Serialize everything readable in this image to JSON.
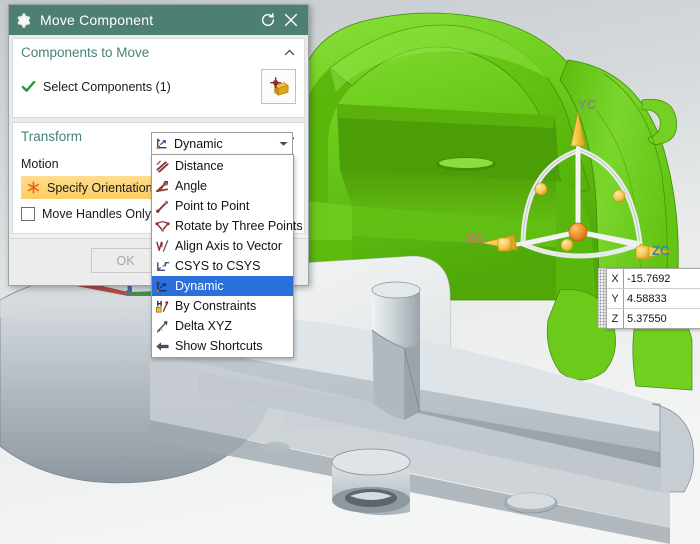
{
  "window": {
    "title": "Move Component",
    "title_icon": "gear-icon",
    "reset_icon": "reset-circular-arrow-icon",
    "close_icon": "close-x-icon",
    "title_bar_color": "#4e7f73"
  },
  "groups": [
    {
      "header": "Components to Move",
      "collapse_icon": "chevron-up-icon",
      "select_components": {
        "label": "Select Components (1)",
        "status_icon": "green-check-icon",
        "button_icon": "select-cube-crosshair-icon"
      }
    },
    {
      "header": "Transform",
      "collapse_icon": "chevron-up-icon",
      "motion_label": "Motion",
      "specify_orientation": {
        "label": "Specify Orientation",
        "icon": "orange-asterisk-icon",
        "highlight_color": "#fccd62"
      },
      "move_handles_only": {
        "label": "Move Handles Only",
        "checked": false
      }
    }
  ],
  "footer": {
    "ok_label": "OK",
    "ok_enabled": false
  },
  "motion_combo": {
    "selected": "Dynamic",
    "icon": "dynamic-csys-icon",
    "arrow_icon": "chevron-down-icon",
    "expanded": true,
    "options": [
      {
        "label": "Distance",
        "icon": "distance-icon",
        "selected": false
      },
      {
        "label": "Angle",
        "icon": "angle-icon",
        "selected": false
      },
      {
        "label": "Point to Point",
        "icon": "point-to-point-icon",
        "selected": false
      },
      {
        "label": "Rotate by Three Points",
        "icon": "rotate-three-points-icon",
        "selected": false
      },
      {
        "label": "Align Axis to Vector",
        "icon": "align-axis-vector-icon",
        "selected": false
      },
      {
        "label": "CSYS to CSYS",
        "icon": "csys-to-csys-icon",
        "selected": false
      },
      {
        "label": "Dynamic",
        "icon": "dynamic-csys-icon",
        "selected": true
      },
      {
        "label": "By Constraints",
        "icon": "by-constraints-icon",
        "selected": false
      },
      {
        "label": "Delta XYZ",
        "icon": "delta-xyz-icon",
        "selected": false
      },
      {
        "label": "Show Shortcuts",
        "icon": "show-shortcuts-icon",
        "selected": false
      }
    ]
  },
  "coordinate_readout": {
    "grip_icon": "drag-grip-dots-icon",
    "rows": [
      {
        "axis": "X",
        "value": "-15.7692"
      },
      {
        "axis": "Y",
        "value": "4.58833"
      },
      {
        "axis": "Z",
        "value": "5.37550"
      }
    ]
  },
  "viewport": {
    "axis_labels": [
      {
        "name": "XC",
        "text": "XC",
        "color": "#d8697a"
      },
      {
        "name": "YC",
        "text": "YC",
        "color": "#7f8e6a"
      },
      {
        "name": "ZC",
        "text": "ZC",
        "color": "#2a8f96"
      }
    ],
    "model_colors": {
      "selected_component": "#6fce1f",
      "static_component": "#b6bdc2",
      "background_top": "#c6cbcf",
      "background_bottom": "#f2f3f3"
    },
    "manipulator": {
      "name": "dynamic-move-triad",
      "origin_handle_color": "#ef8a2c",
      "axis_handle_color": "#f2c14b",
      "arrow_color": "#f5cd55"
    }
  }
}
